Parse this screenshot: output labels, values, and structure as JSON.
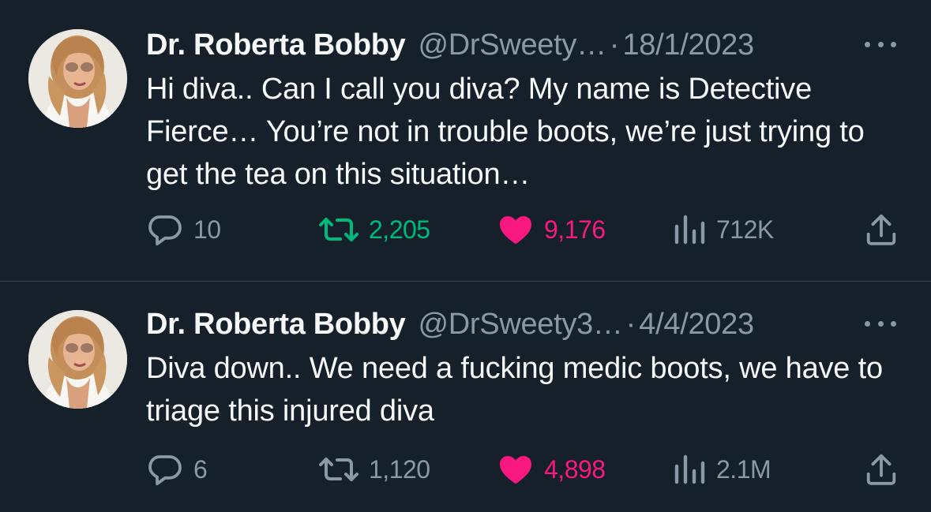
{
  "colors": {
    "background": "#15202b",
    "text_primary": "#f7f9f9",
    "text_secondary": "#8b98a5",
    "retweet_active": "#00ba7c",
    "like_active": "#f91880",
    "divider": "#38444d"
  },
  "tweets": [
    {
      "display_name": "Dr. Roberta Bobby",
      "handle": "@DrSweety…",
      "separator": "·",
      "date": "18/1/2023",
      "text": "Hi diva.. Can I call you diva? My name is Detective Fierce… You’re not in trouble boots, we’re just trying to get the tea on this situation…",
      "replies": "10",
      "retweets": "2,205",
      "likes": "9,176",
      "views": "712K",
      "retweeted": true,
      "liked": true,
      "icons": [
        "avatar-photo",
        "more-icon",
        "reply-icon",
        "retweet-icon",
        "heart-icon",
        "views-icon",
        "share-icon"
      ]
    },
    {
      "display_name": "Dr. Roberta Bobby",
      "handle": "@DrSweety3…",
      "separator": "·",
      "date": "4/4/2023",
      "text": "Diva down.. We need a fucking medic boots, we have to triage this injured diva",
      "replies": "6",
      "retweets": "1,120",
      "likes": "4,898",
      "views": "2.1M",
      "retweeted": false,
      "liked": true,
      "icons": [
        "avatar-photo",
        "more-icon",
        "reply-icon",
        "retweet-icon",
        "heart-icon",
        "views-icon",
        "share-icon"
      ]
    }
  ]
}
